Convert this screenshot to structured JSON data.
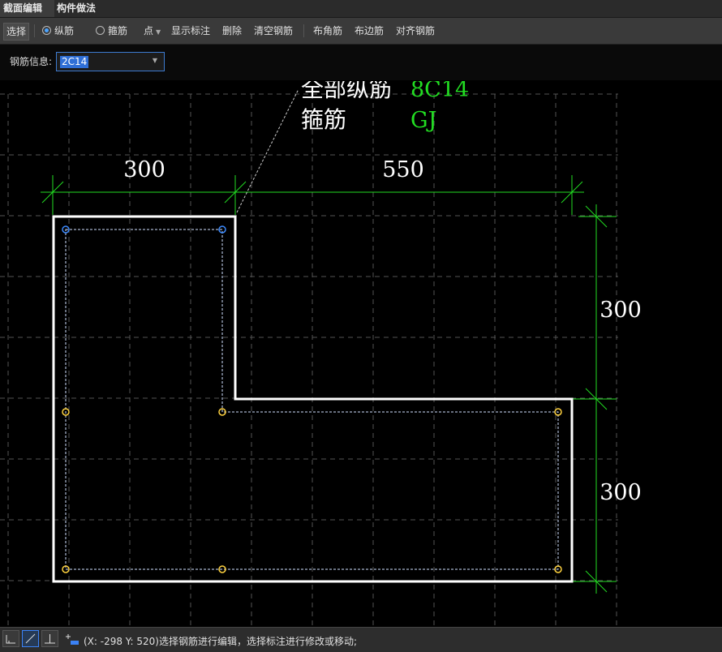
{
  "tabs": [
    {
      "label": "截面编辑",
      "active": true
    },
    {
      "label": "构件做法",
      "active": false
    }
  ],
  "toolbar": {
    "select_label": "选择",
    "radio_longitudinal": "纵筋",
    "radio_stirrup": "箍筋",
    "point_label": "点",
    "show_annotation": "显示标注",
    "delete": "删除",
    "clear_rebar": "清空钢筋",
    "corner_rebar": "布角筋",
    "edge_rebar": "布边筋",
    "align_rebar": "对齐钢筋"
  },
  "info": {
    "label": "钢筋信息:",
    "value": "2C14"
  },
  "annotation": {
    "line1_label": "全部纵筋",
    "line1_value": "8C14",
    "line2_label": "箍筋",
    "line2_value": "GJ"
  },
  "dimensions": {
    "top_left": "300",
    "top_right": "550",
    "right_top": "300",
    "right_bottom": "300"
  },
  "status": {
    "text": "(X: -298 Y: 520)选择钢筋进行编辑，选择标注进行修改或移动;"
  },
  "colors": {
    "dimension": "#22dd22",
    "outline": "#ffffff",
    "grid": "#555555",
    "rebar_selected": "#3d8bff",
    "rebar_normal": "#ffd23f"
  }
}
